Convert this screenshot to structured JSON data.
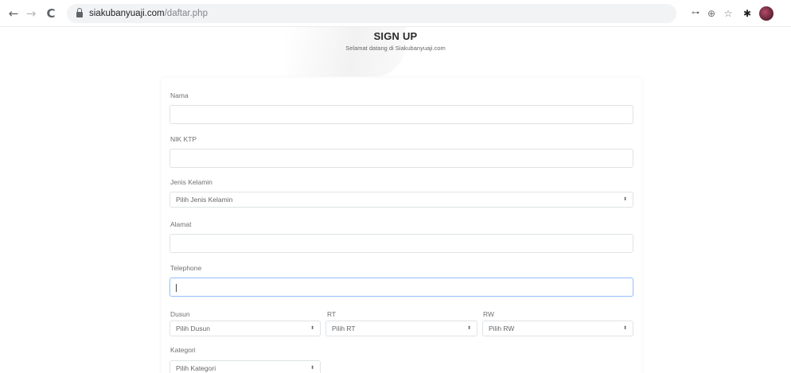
{
  "browser": {
    "url_host": "siakubanyuaji.com",
    "url_path": "/daftar.php",
    "icons": {
      "back": "←",
      "forward": "→",
      "reload": "C",
      "key": "⊶",
      "zoom": "⊕",
      "star": "☆",
      "extension": "✱"
    }
  },
  "header": {
    "title": "SIGN UP",
    "subtitle": "Selamat datang di Siakubanyuaji.com"
  },
  "form": {
    "nama": {
      "label": "Nama",
      "value": ""
    },
    "nik": {
      "label": "NIK KTP",
      "value": ""
    },
    "jenis_kelamin": {
      "label": "Jenis Kelamin",
      "selected": "Pilih Jenis Kelamin"
    },
    "alamat": {
      "label": "Alamat",
      "value": ""
    },
    "telephone": {
      "label": "Telephone",
      "value": ""
    },
    "dusun": {
      "label": "Dusun",
      "selected": "Pilih Dusun"
    },
    "rt": {
      "label": "RT",
      "selected": "Pilih RT"
    },
    "rw": {
      "label": "RW",
      "selected": "Pilih RW"
    },
    "kategori": {
      "label": "Kategori",
      "selected": "Pilih Kategori"
    }
  },
  "colors": {
    "focus_border": "#9ec5fe",
    "input_border": "#dfe3e6"
  }
}
